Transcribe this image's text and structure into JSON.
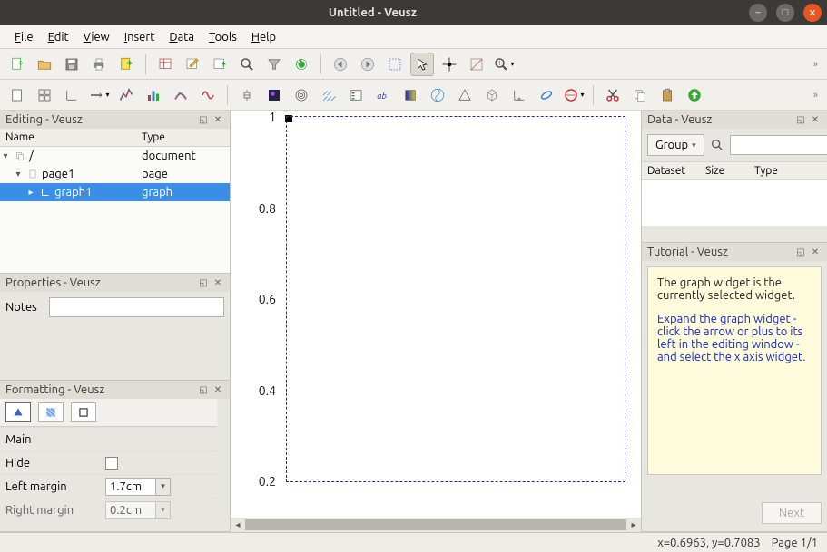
{
  "window": {
    "title": "Untitled - Veusz"
  },
  "menus": {
    "file": "File",
    "file_u": "F",
    "edit": "Edit",
    "edit_u": "E",
    "view": "View",
    "view_u": "V",
    "insert": "Insert",
    "insert_u": "I",
    "data": "Data",
    "data_u": "D",
    "tools": "Tools",
    "tools_u": "T",
    "help": "Help",
    "help_u": "H"
  },
  "panels": {
    "editing": {
      "title": "Editing - Veusz",
      "cols": {
        "name": "Name",
        "type": "Type"
      },
      "rows": [
        {
          "name": "/",
          "type": "document",
          "indent": 0
        },
        {
          "name": "page1",
          "type": "page",
          "indent": 1
        },
        {
          "name": "graph1",
          "type": "graph",
          "indent": 2,
          "selected": true
        }
      ]
    },
    "properties": {
      "title": "Properties - Veusz",
      "notes_label": "Notes",
      "notes_value": ""
    },
    "formatting": {
      "title": "Formatting - Veusz",
      "rows": {
        "main": "Main",
        "hide_label": "Hide",
        "left_margin_label": "Left margin",
        "left_margin_value": "1.7cm",
        "right_margin_label": "Right margin",
        "right_margin_value": "0.2cm"
      }
    },
    "data": {
      "title": "Data - Veusz",
      "group_label": "Group",
      "cols": {
        "dataset": "Dataset",
        "size": "Size",
        "type": "Type"
      }
    },
    "tutorial": {
      "title": "Tutorial - Veusz",
      "p1": "The graph widget is the currently selected widget.",
      "p2": "Expand the graph widget - click the arrow or plus to its left in the editing window - and select the x axis widget.",
      "next": "Next"
    }
  },
  "chart_data": {
    "type": "line",
    "series": [],
    "xlim": [
      0,
      1
    ],
    "ylim": [
      0,
      1
    ],
    "yticks": [
      0.2,
      0.4,
      0.6,
      0.8,
      1
    ],
    "ytick_labels": [
      "0.2",
      "0.4",
      "0.6",
      "0.8",
      "1"
    ],
    "xlabel": "",
    "ylabel": "",
    "title": ""
  },
  "status": {
    "coords": "x=0.6963, y=0.7083",
    "page": "Page 1/1"
  }
}
